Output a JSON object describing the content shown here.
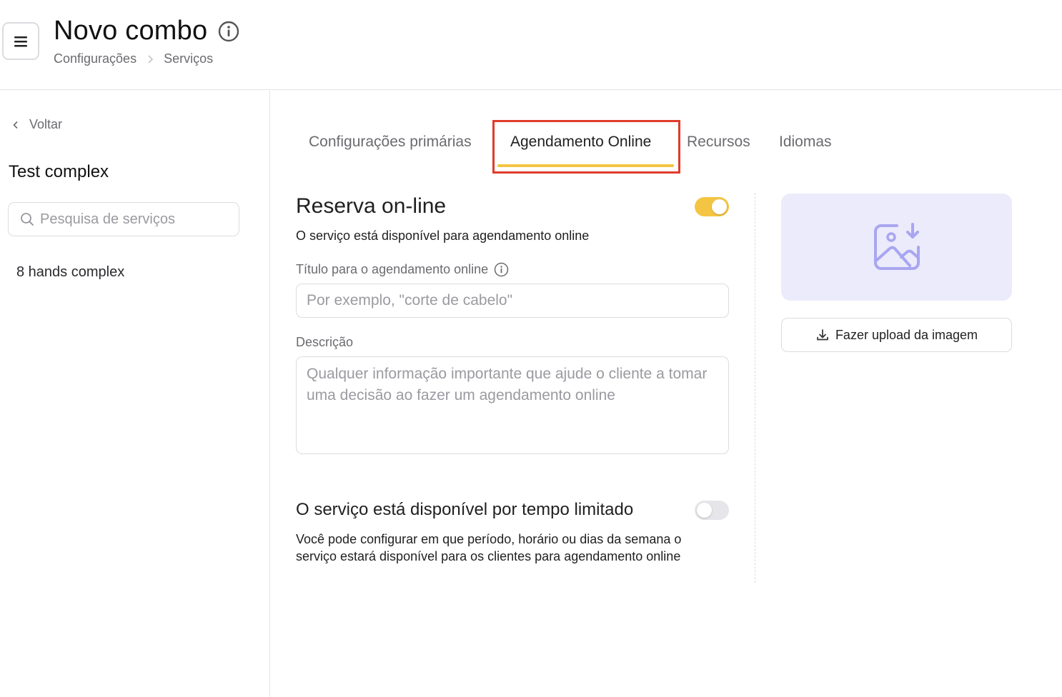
{
  "header": {
    "title": "Novo combo",
    "breadcrumb": [
      "Configurações",
      "Serviços"
    ],
    "menu_icon": "hamburger-menu-icon",
    "info_icon": "info-icon"
  },
  "sidebar": {
    "back_label": "Voltar",
    "title": "Test complex",
    "search_placeholder": "Pesquisa de serviços",
    "items": [
      {
        "label": "8 hands complex"
      }
    ]
  },
  "tabs": [
    {
      "label": "Configurações primárias",
      "active": false
    },
    {
      "label": "Agendamento Online",
      "active": true
    },
    {
      "label": "Recursos",
      "active": false
    },
    {
      "label": "Idiomas",
      "active": false
    }
  ],
  "online_booking": {
    "title": "Reserva on-line",
    "enabled": true,
    "description": "O serviço está disponível para agendamento online",
    "title_field_label": "Título para o agendamento online",
    "title_field_value": "",
    "title_field_placeholder": "Por exemplo, \"corte de cabelo\"",
    "description_field_label": "Descrição",
    "description_field_value": "",
    "description_field_placeholder": "Qualquer informação importante que ajude o cliente a tomar uma decisão ao fazer um agendamento online"
  },
  "limited_time": {
    "title": "O serviço está disponível por tempo limitado",
    "enabled": false,
    "description": "Você pode configurar em que período, horário ou dias da semana o serviço estará disponível para os clientes para agendamento online"
  },
  "image_upload": {
    "button_label": "Fazer upload da imagem",
    "placeholder_icon": "image-download-icon"
  },
  "colors": {
    "accent": "#f4c542",
    "highlight_border": "#e03c2a",
    "image_placeholder_bg": "#ebebfb",
    "image_icon": "#a9a6f0"
  }
}
